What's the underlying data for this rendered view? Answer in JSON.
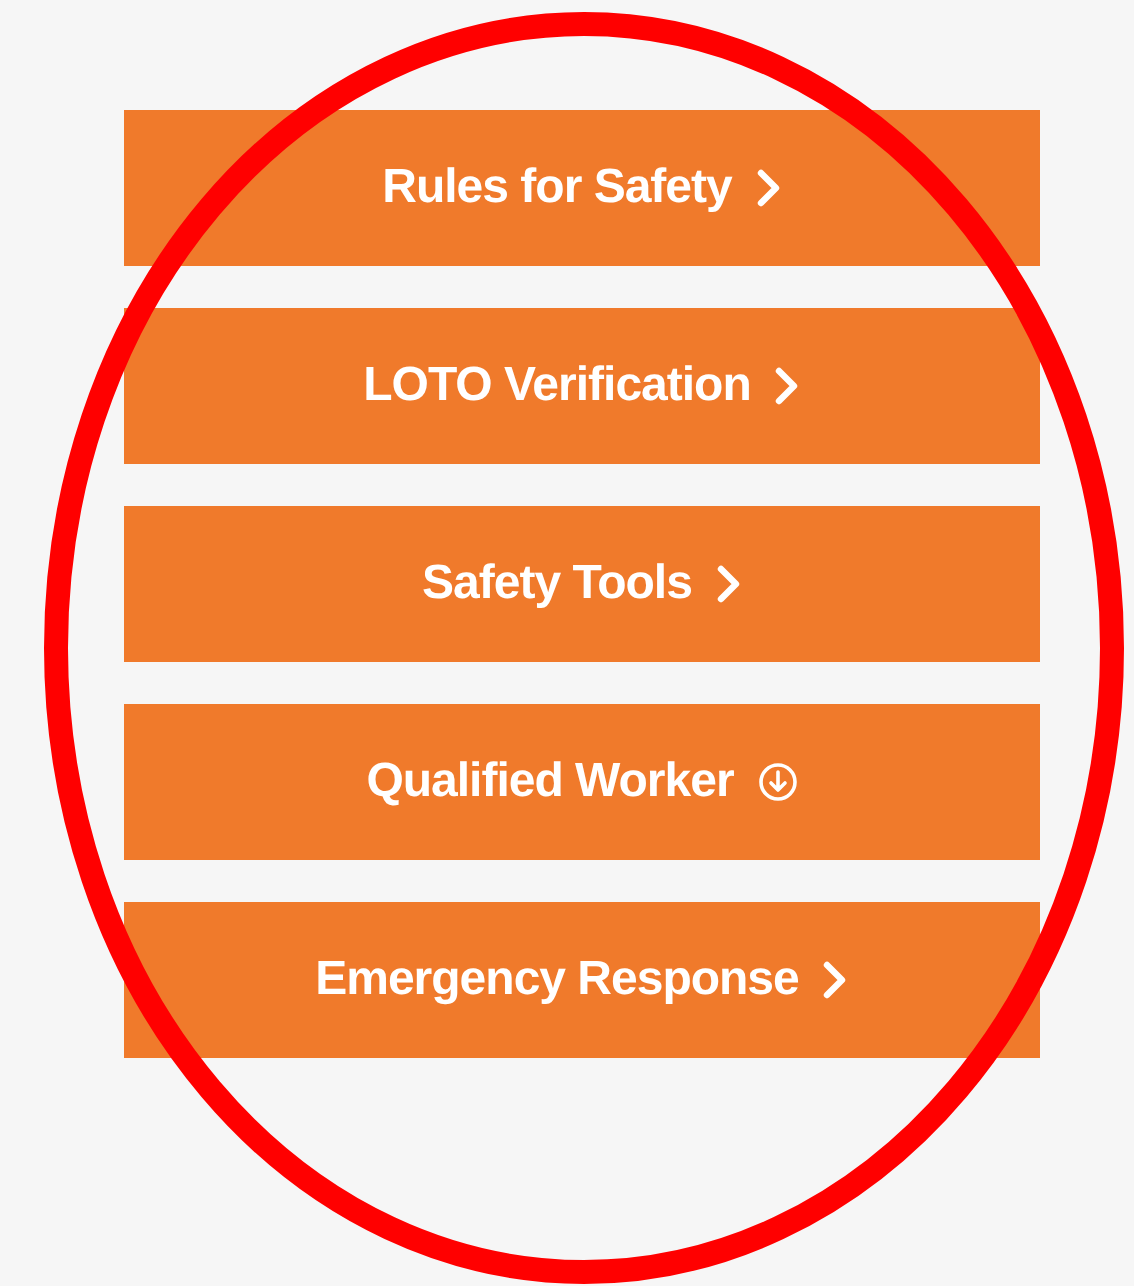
{
  "buttons": [
    {
      "label": "Rules for Safety",
      "kind": "chevron"
    },
    {
      "label": "LOTO Verification",
      "kind": "chevron"
    },
    {
      "label": "Safety Tools",
      "kind": "chevron"
    },
    {
      "label": "Qualified Worker",
      "kind": "download"
    },
    {
      "label": "Emergency Response",
      "kind": "chevron"
    }
  ],
  "annotation": {
    "kind": "ellipse",
    "color": "#ff0000"
  }
}
